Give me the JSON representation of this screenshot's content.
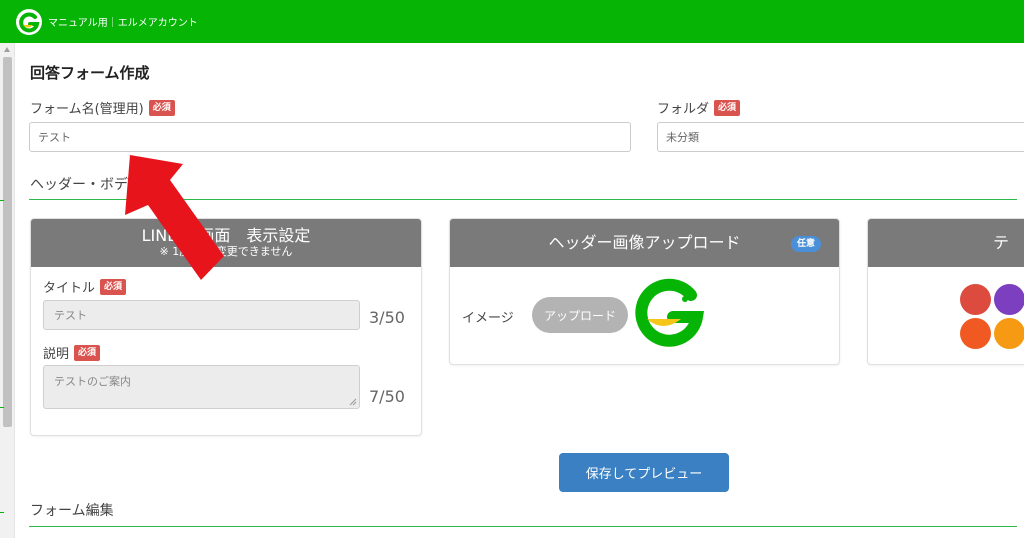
{
  "topbar": {
    "account_name": "マニュアル用｜エルメアカウント"
  },
  "page": {
    "title": "回答フォーム作成"
  },
  "form": {
    "name_label": "フォーム名(管理用)",
    "name_required": "必須",
    "name_value": "テスト",
    "folder_label": "フォルダ",
    "folder_required": "必須",
    "folder_value": "未分類"
  },
  "sections": {
    "header_body": "ヘッダー・ボデ  集",
    "form_edit": "フォーム編集"
  },
  "line_card": {
    "title": "LINE        ク画面　表示設定",
    "note": "※ 1度      ると変更できません",
    "title_label": "タイトル",
    "title_required": "必須",
    "title_value": "テスト",
    "title_counter": "3/50",
    "desc_label": "説明",
    "desc_required": "必須",
    "desc_value": "テストのご案内",
    "desc_counter": "7/50"
  },
  "header_image_card": {
    "title": "ヘッダー画像アップロード",
    "optional": "任意",
    "image_label": "イメージ",
    "upload_label": "アップロード"
  },
  "theme_card": {
    "title": "テ",
    "colors": [
      "#dc4b3e",
      "#7b3fbf",
      "#f05a22",
      "#f59a12"
    ]
  },
  "actions": {
    "save_preview": "保存してプレビュー"
  },
  "colors": {
    "brand_green": "#06b406",
    "section_line": "#2db84a",
    "primary_blue": "#3a80c2",
    "required_red": "#d9534f",
    "arrow_red": "#e8141b"
  }
}
